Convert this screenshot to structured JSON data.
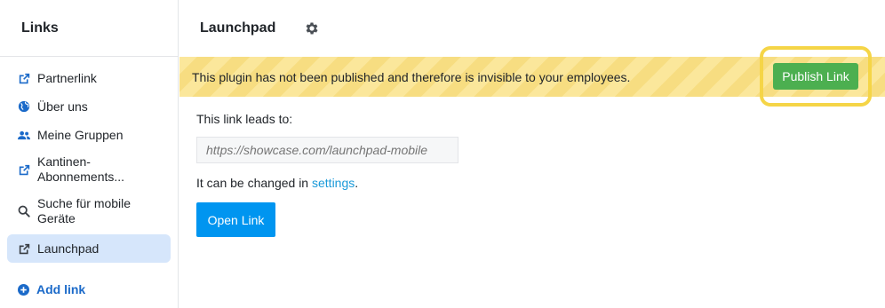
{
  "sidebar": {
    "title": "Links",
    "items": [
      {
        "label": "Partnerlink",
        "icon": "external-link-icon"
      },
      {
        "label": "Über uns",
        "icon": "globe-icon"
      },
      {
        "label": "Meine Gruppen",
        "icon": "users-icon"
      },
      {
        "label": "Kantinen-Abonnements...",
        "icon": "external-link-icon"
      },
      {
        "label": "Suche für mobile Geräte",
        "icon": "search-icon"
      },
      {
        "label": "Launchpad",
        "icon": "external-link-icon",
        "active": true
      }
    ],
    "add_link_label": "Add link"
  },
  "main": {
    "title": "Launchpad",
    "banner": {
      "text": "This plugin has not been published and therefore is invisible to your employees.",
      "publish_label": "Publish Link"
    },
    "leads_label": "This link leads to:",
    "url_placeholder": "https://showcase.com/launchpad-mobile",
    "changed_prefix": "It can be changed in",
    "settings_link": "settings",
    "changed_suffix": ".",
    "open_label": "Open Link"
  },
  "colors": {
    "accent": "#0095f0",
    "link": "#1a9ad9",
    "publish": "#4caf50",
    "highlight": "#f5d547",
    "active_bg": "#d6e6fb"
  }
}
